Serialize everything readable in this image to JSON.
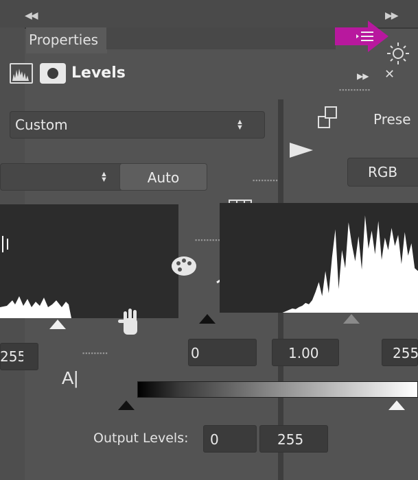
{
  "panel": {
    "title": "Properties",
    "adjustment_title": "Levels"
  },
  "preset": {
    "label": "Custom",
    "right_label_partial": "Prese"
  },
  "channel": {
    "right_value": "RGB"
  },
  "auto_button": {
    "label": "Auto"
  },
  "input_levels": {
    "black": "0",
    "midtone": "1.00",
    "white": "255",
    "left_partial": "255"
  },
  "output_levels": {
    "label": "Output Levels:",
    "black": "0",
    "white": "255"
  },
  "histogram": {
    "shape": [
      0,
      0,
      0,
      0,
      0,
      0,
      0,
      0,
      0,
      0,
      0,
      0,
      0,
      0,
      0,
      0,
      0,
      0,
      0,
      0,
      2,
      4,
      6,
      5,
      8,
      10,
      14,
      12,
      18,
      30,
      44,
      24,
      60,
      28,
      80,
      120,
      34,
      90,
      64,
      130,
      98,
      74,
      110,
      62,
      140,
      92,
      118,
      84,
      132,
      76,
      108,
      90,
      122,
      96,
      112,
      70,
      116,
      82,
      100,
      64,
      60
    ]
  },
  "colors": {
    "accent": "#B8189E",
    "panel_bg": "#535353",
    "histogram_bg": "#2A2A2A",
    "histogram_fill": "#FFFFFF"
  },
  "icons": {
    "flyout_menu": "flyout-menu-icon",
    "levels_histogram": "histogram-icon",
    "layer_mask": "layer-mask-icon",
    "clip": "clip-to-layer-icon",
    "visibility": "eye-icon",
    "reset": "reset-icon",
    "delete": "trash-icon",
    "eyedropper_black": "black-eyedropper-icon",
    "eyedropper_gray": "gray-eyedropper-icon",
    "eyedropper_white": "white-eyedropper-icon",
    "hand": "on-image-adjust-icon"
  }
}
